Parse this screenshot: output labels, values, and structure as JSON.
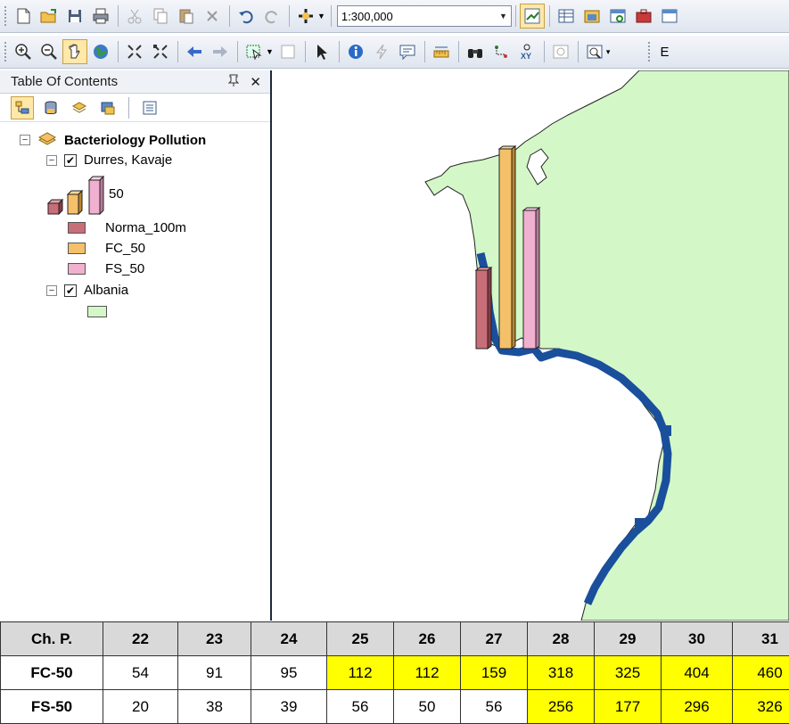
{
  "toolbar": {
    "scale_value": "1:300,000",
    "cut_label": "E"
  },
  "toc": {
    "title": "Table Of Contents",
    "pin_glyph": "p",
    "close_glyph": "✕",
    "layers": {
      "group_name": "Bacteriology Pollution",
      "layer1": "Durres, Kavaje",
      "chart_size_label": "50",
      "legend": [
        {
          "label": "Norma_100m",
          "color": "#c86e78"
        },
        {
          "label": "FC_50",
          "color": "#f5c06a"
        },
        {
          "label": "FS_50",
          "color": "#f0b0d0"
        }
      ],
      "layer2": "Albania",
      "layer2_color": "#d4f7c8"
    }
  },
  "map": {
    "land_color": "#d4f7c8",
    "coast_color": "#1a4f9c",
    "bars": [
      {
        "name": "Norma_100m",
        "color": "#c86e78"
      },
      {
        "name": "FC_50",
        "color": "#f5c06a"
      },
      {
        "name": "FS_50",
        "color": "#f0b0d0"
      }
    ]
  },
  "table": {
    "headers": [
      "Ch. P.",
      "22",
      "23",
      "24",
      "25",
      "26",
      "27",
      "28",
      "29",
      "30",
      "31"
    ],
    "rows": [
      {
        "label": "FC-50",
        "cells": [
          "54",
          "91",
          "95",
          "112",
          "112",
          "159",
          "318",
          "325",
          "404",
          "460"
        ]
      },
      {
        "label": "FS-50",
        "cells": [
          "20",
          "38",
          "39",
          "56",
          "50",
          "56",
          "256",
          "177",
          "296",
          "326"
        ]
      }
    ],
    "highlight_color": "#ffff00"
  }
}
